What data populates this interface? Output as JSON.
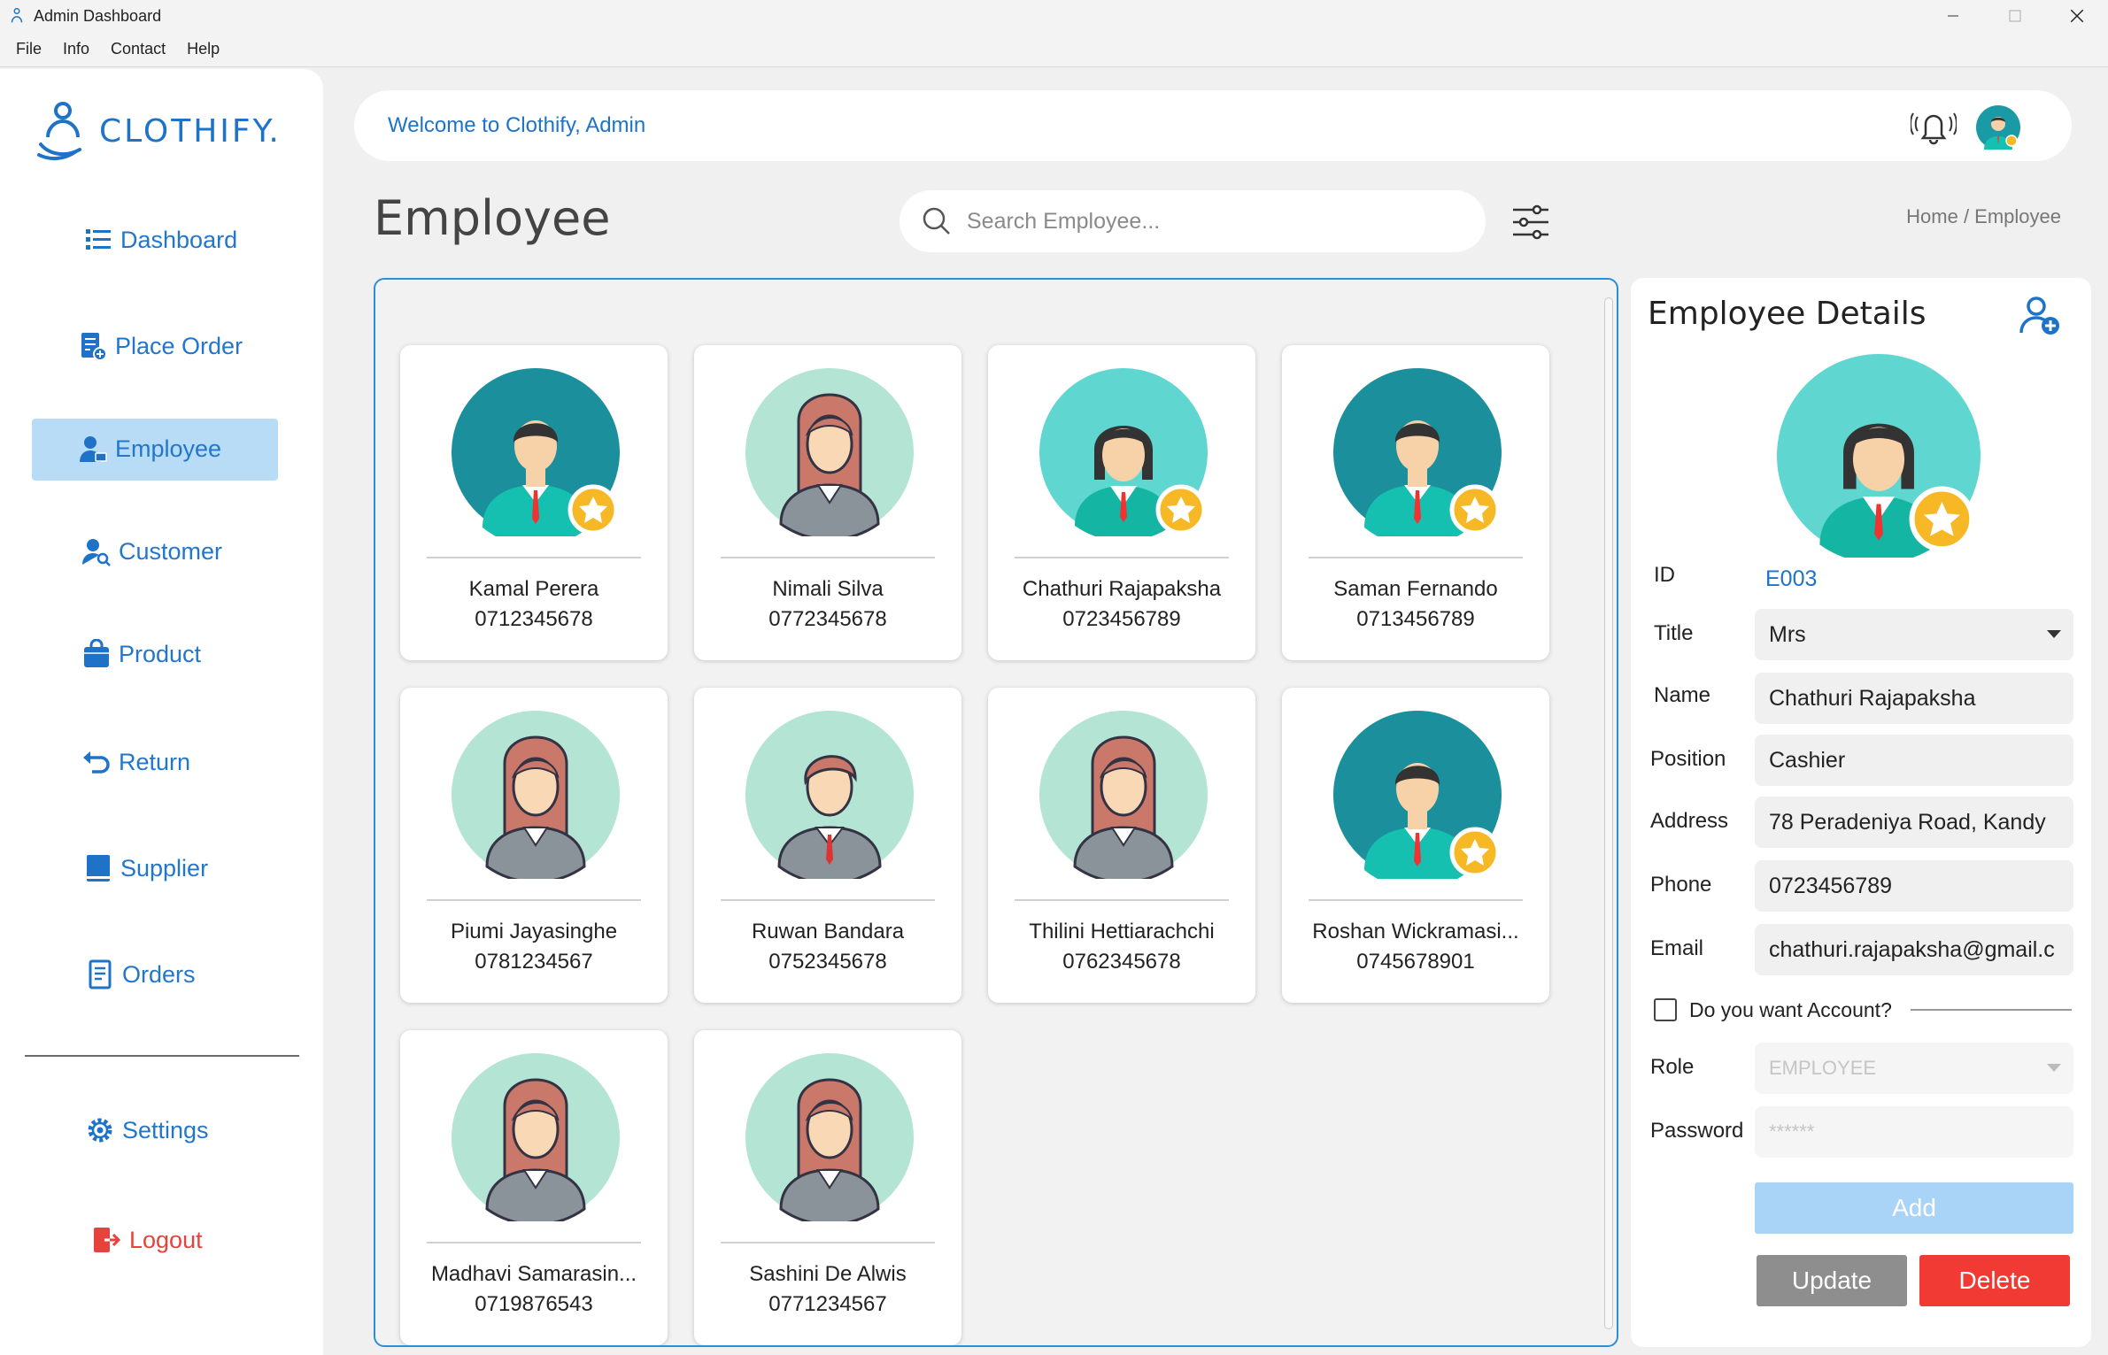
{
  "window": {
    "title": "Admin Dashboard",
    "menu": [
      "File",
      "Info",
      "Contact",
      "Help"
    ]
  },
  "sidebar": {
    "logo": "CLOTHIFY.",
    "items": [
      {
        "label": "Dashboard",
        "icon": "list-icon"
      },
      {
        "label": "Place Order",
        "icon": "order-form-icon"
      },
      {
        "label": "Employee",
        "icon": "employee-icon",
        "active": true
      },
      {
        "label": "Customer",
        "icon": "customer-search-icon"
      },
      {
        "label": "Product",
        "icon": "product-bag-icon"
      },
      {
        "label": "Return",
        "icon": "return-arrow-icon"
      },
      {
        "label": "Supplier",
        "icon": "supplier-book-icon"
      },
      {
        "label": "Orders",
        "icon": "orders-receipt-icon"
      }
    ],
    "settings": "Settings",
    "logout": "Logout"
  },
  "header": {
    "welcome": "Welcome to Clothify, Admin"
  },
  "page": {
    "title": "Employee",
    "search_placeholder": "Search Employee...",
    "breadcrumb": "Home / Employee"
  },
  "employees": [
    {
      "name": "Kamal Perera",
      "phone": "0712345678",
      "avatar": "male-teal"
    },
    {
      "name": "Nimali Silva",
      "phone": "0772345678",
      "avatar": "female-grey"
    },
    {
      "name": "Chathuri Rajapaksha",
      "phone": "0723456789",
      "avatar": "female-teal"
    },
    {
      "name": "Saman Fernando",
      "phone": "0713456789",
      "avatar": "male-teal"
    },
    {
      "name": "Piumi Jayasinghe",
      "phone": "0781234567",
      "avatar": "female-grey"
    },
    {
      "name": "Ruwan Bandara",
      "phone": "0752345678",
      "avatar": "male-grey"
    },
    {
      "name": "Thilini Hettiarachchi",
      "phone": "0762345678",
      "avatar": "female-grey"
    },
    {
      "name": "Roshan Wickramasi...",
      "phone": "0745678901",
      "avatar": "male-teal"
    },
    {
      "name": "Madhavi Samarasin...",
      "phone": "0719876543",
      "avatar": "female-grey"
    },
    {
      "name": "Sashini De Alwis",
      "phone": "0771234567",
      "avatar": "female-grey"
    }
  ],
  "details": {
    "heading": "Employee Details",
    "labels": {
      "id": "ID",
      "title": "Title",
      "name": "Name",
      "position": "Position",
      "address": "Address",
      "phone": "Phone",
      "email": "Email",
      "account": "Do you want Account?",
      "role": "Role",
      "password": "Password"
    },
    "values": {
      "id": "E003",
      "title": "Mrs",
      "name": "Chathuri Rajapaksha",
      "position": "Cashier",
      "address": "78 Peradeniya Road, Kandy",
      "phone": "0723456789",
      "email": "chathuri.rajapaksha@gmail.c",
      "role": "EMPLOYEE",
      "password": "******"
    },
    "buttons": {
      "add": "Add",
      "update": "Update",
      "delete": "Delete"
    }
  },
  "colors": {
    "accent": "#1e73c8",
    "active_nav": "#b8dcf6",
    "delete": "#f03a33",
    "update": "#8e8e8e",
    "add": "#a9d4f7"
  }
}
